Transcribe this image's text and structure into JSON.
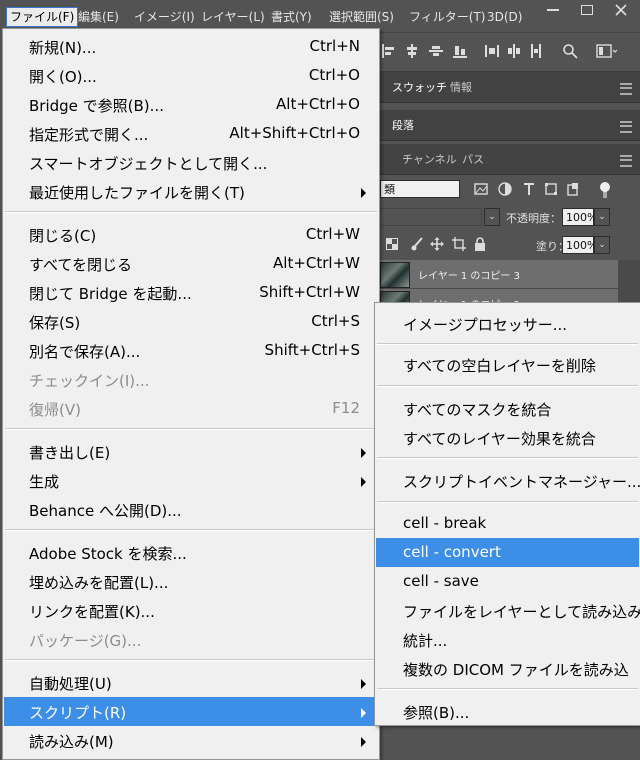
{
  "menubar": {
    "items": [
      "ファイル(F)",
      "編集(E)",
      "イメージ(I)",
      "レイヤー(L)",
      "書式(Y)",
      "選択範囲(S)",
      "フィルター(T)",
      "3D(D)"
    ]
  },
  "panels": {
    "tabs_row1": [
      "スウォッチ",
      "情報"
    ],
    "tabs_row2": [
      "段落"
    ],
    "tabs_row3": [
      "チャンネル",
      "パス"
    ],
    "kind_label": "類",
    "opacity_label": "不透明度：",
    "opacity_value": "100%",
    "fill_label": "塗り：",
    "fill_value": "100%",
    "layers": [
      "レイヤー 1 のコピー 3",
      "レイヤー 1 のコピー 2"
    ]
  },
  "file_menu": {
    "items": [
      {
        "label": "新規(N)...",
        "shortcut": "Ctrl+N"
      },
      {
        "label": "開く(O)...",
        "shortcut": "Ctrl+O"
      },
      {
        "label": "Bridge で参照(B)...",
        "shortcut": "Alt+Ctrl+O"
      },
      {
        "label": "指定形式で開く...",
        "shortcut": "Alt+Shift+Ctrl+O"
      },
      {
        "label": "スマートオブジェクトとして開く...",
        "shortcut": ""
      },
      {
        "label": "最近使用したファイルを開く(T)",
        "shortcut": ""
      },
      {
        "label": "閉じる(C)",
        "shortcut": "Ctrl+W"
      },
      {
        "label": "すべてを閉じる",
        "shortcut": "Alt+Ctrl+W"
      },
      {
        "label": "閉じて Bridge を起動...",
        "shortcut": "Shift+Ctrl+W"
      },
      {
        "label": "保存(S)",
        "shortcut": "Ctrl+S"
      },
      {
        "label": "別名で保存(A)...",
        "shortcut": "Shift+Ctrl+S"
      },
      {
        "label": "チェックイン(I)...",
        "shortcut": ""
      },
      {
        "label": "復帰(V)",
        "shortcut": "F12"
      },
      {
        "label": "書き出し(E)",
        "shortcut": ""
      },
      {
        "label": "生成",
        "shortcut": ""
      },
      {
        "label": "Behance へ公開(D)...",
        "shortcut": ""
      },
      {
        "label": "Adobe Stock を検索...",
        "shortcut": ""
      },
      {
        "label": "埋め込みを配置(L)...",
        "shortcut": ""
      },
      {
        "label": "リンクを配置(K)...",
        "shortcut": ""
      },
      {
        "label": "パッケージ(G)...",
        "shortcut": ""
      },
      {
        "label": "自動処理(U)",
        "shortcut": ""
      },
      {
        "label": "スクリプト(R)",
        "shortcut": ""
      },
      {
        "label": "読み込み(M)",
        "shortcut": ""
      }
    ]
  },
  "script_menu": {
    "items": [
      {
        "label": "イメージプロセッサー..."
      },
      {
        "label": "すべての空白レイヤーを削除"
      },
      {
        "label": "すべてのマスクを統合"
      },
      {
        "label": "すべてのレイヤー効果を統合"
      },
      {
        "label": "スクリプトイベントマネージャー..."
      },
      {
        "label": "cell - break"
      },
      {
        "label": "cell - convert"
      },
      {
        "label": "cell - save"
      },
      {
        "label": "ファイルをレイヤーとして読み込み..."
      },
      {
        "label": "統計..."
      },
      {
        "label": "複数の DICOM ファイルを読み込"
      },
      {
        "label": "参照(B)..."
      }
    ]
  },
  "colors": {
    "highlight": "#3d8ee6",
    "menu_bg": "#f0f0f0",
    "app_bg": "#535353"
  }
}
